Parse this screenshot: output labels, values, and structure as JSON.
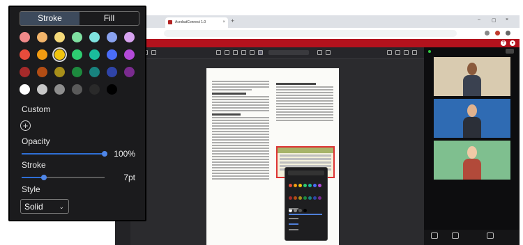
{
  "browser": {
    "tab_title": "AcrobatConnect 1.0",
    "tab_close": "×",
    "tab_new": "+",
    "window_controls": [
      "–",
      "▢",
      "×"
    ],
    "accent_color": "#b3121d"
  },
  "picker": {
    "tabs": [
      {
        "label": "Stroke",
        "active": true
      },
      {
        "label": "Fill",
        "active": false
      }
    ],
    "swatch_rows": [
      [
        "#f08a8a",
        "#f3b56b",
        "#f4d97a",
        "#7fe0a1",
        "#7fe3e0",
        "#8aa3f0",
        "#d7a3f0"
      ],
      [
        "#e74c3c",
        "#f39c12",
        "#f1c40f",
        "#2ecc71",
        "#1abc9c",
        "#4a6cf7",
        "#b44ad9"
      ],
      [
        "#a52a2a",
        "#b34d14",
        "#a88f1a",
        "#1d8a3e",
        "#18827e",
        "#2f44a8",
        "#7a2b8f"
      ],
      [
        "#ffffff",
        "#c8c8c8",
        "#8e8e8e",
        "#5a5a5a",
        "#2a2a2a",
        "#000000"
      ]
    ],
    "selected_swatch": "#f1c40f",
    "custom_label": "Custom",
    "custom_icon": "plus-circle-icon",
    "opacity_label": "Opacity",
    "opacity_value": "100%",
    "opacity_fraction": 1.0,
    "stroke_label": "Stroke",
    "stroke_value": "7pt",
    "stroke_fraction": 0.27,
    "style_label": "Style",
    "style_value": "Solid",
    "style_chevron": "⌄"
  }
}
